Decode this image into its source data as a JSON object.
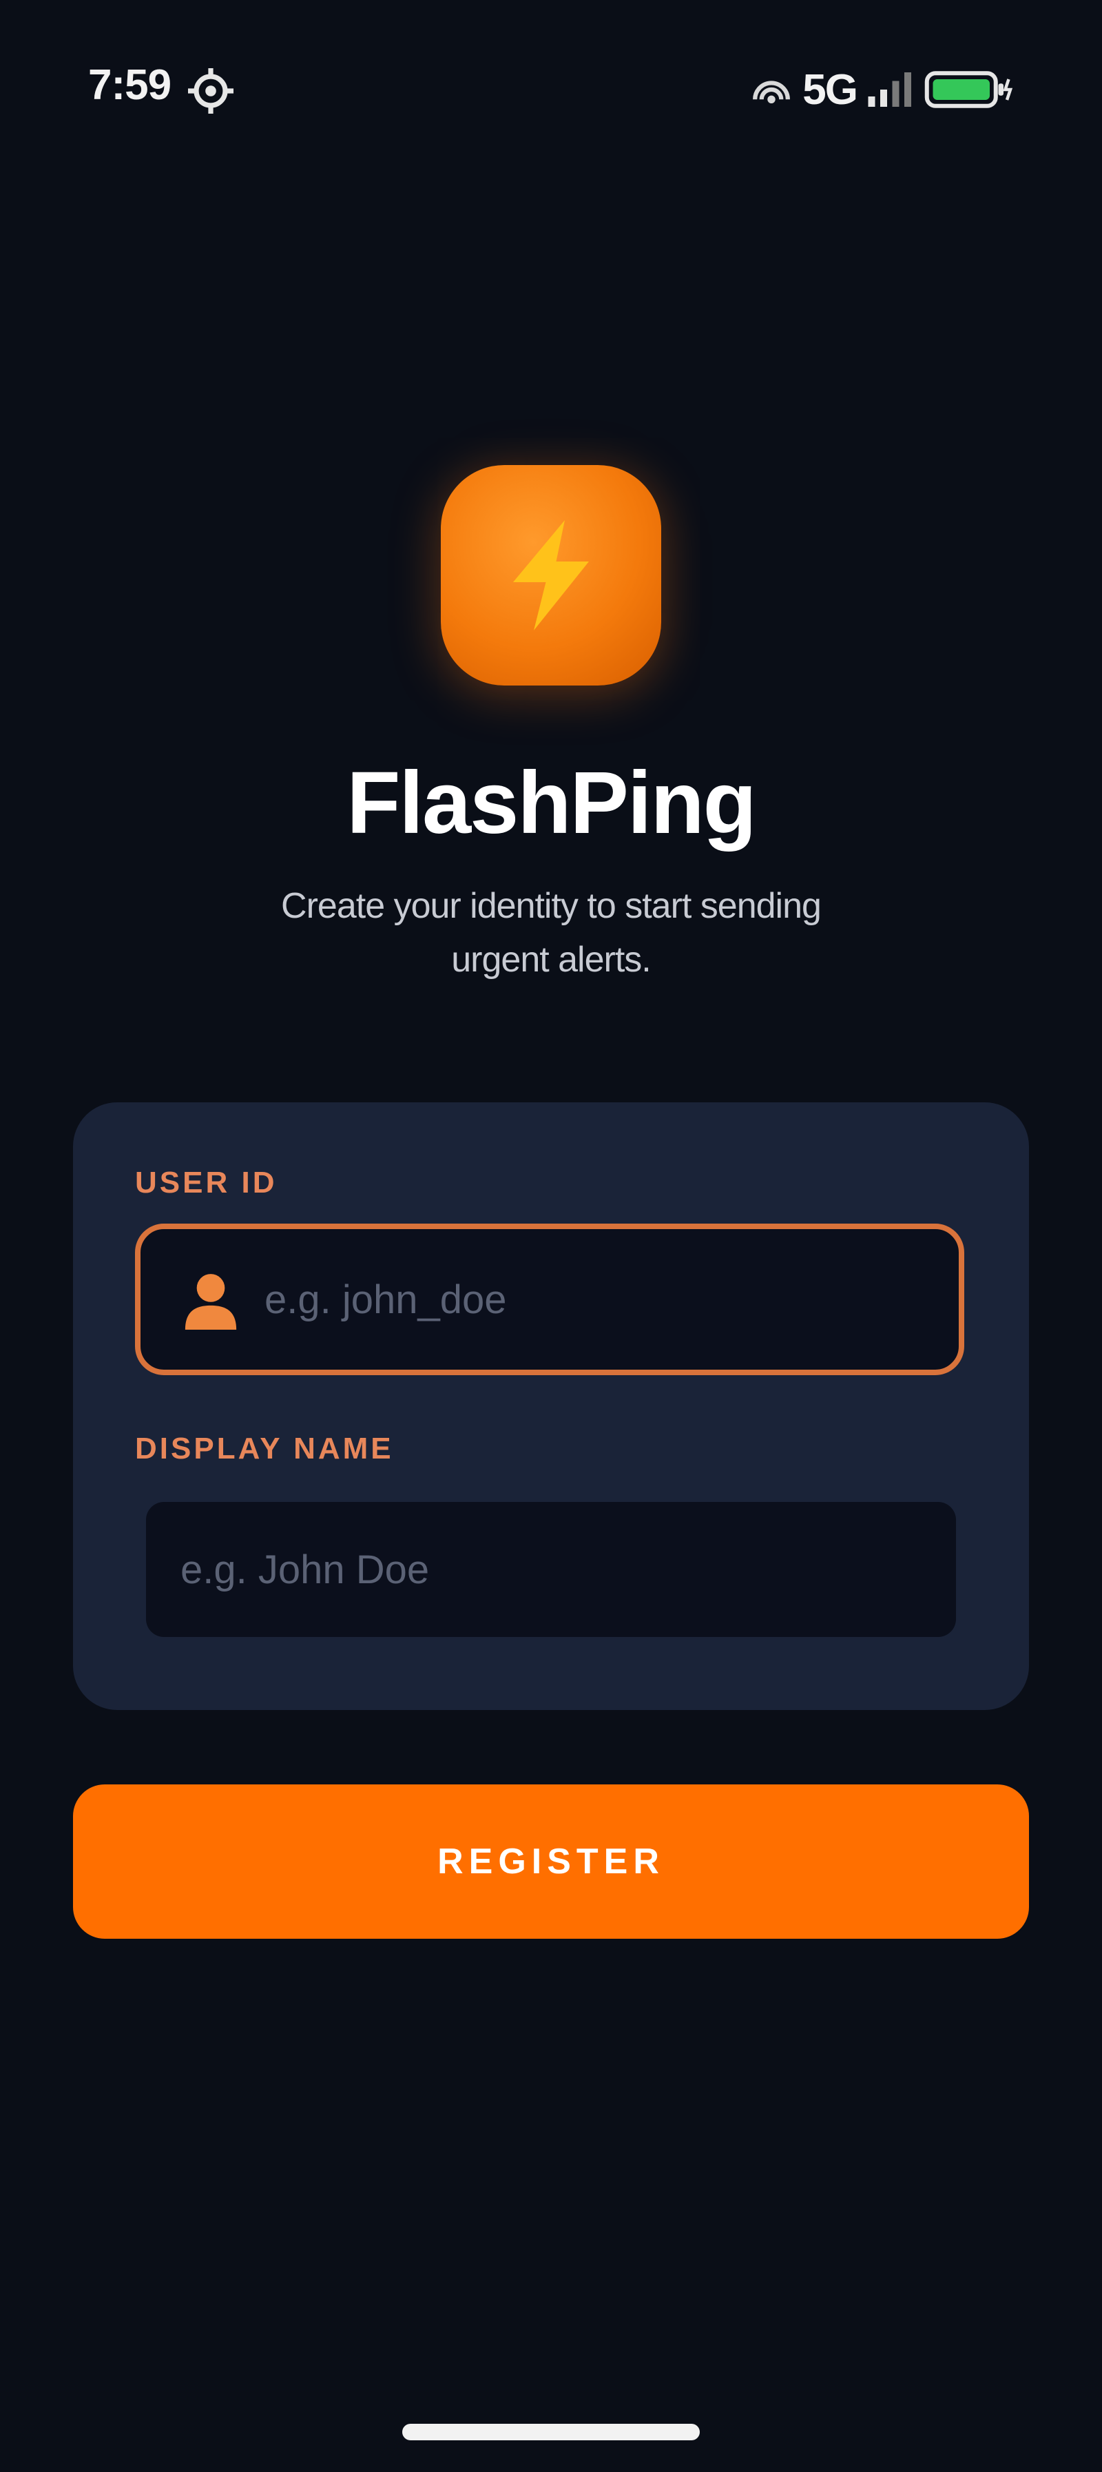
{
  "status_bar": {
    "time": "7:59",
    "network": "5G",
    "icons": [
      "location-target-icon",
      "hotspot-icon",
      "signal-icon",
      "battery-charging-icon"
    ],
    "battery_color": "#34c759"
  },
  "app": {
    "name": "FlashPing",
    "tagline": "Create your identity to start sending urgent alerts.",
    "logo_icon": "lightning-bolt-icon",
    "accent_color": "#ff6f00"
  },
  "form": {
    "user_id": {
      "label": "USER ID",
      "placeholder": "e.g. john_doe",
      "value": "",
      "icon": "user-icon"
    },
    "display_name": {
      "label": "DISPLAY NAME",
      "placeholder": "e.g. John Doe",
      "value": ""
    }
  },
  "actions": {
    "register_label": "REGISTER"
  }
}
